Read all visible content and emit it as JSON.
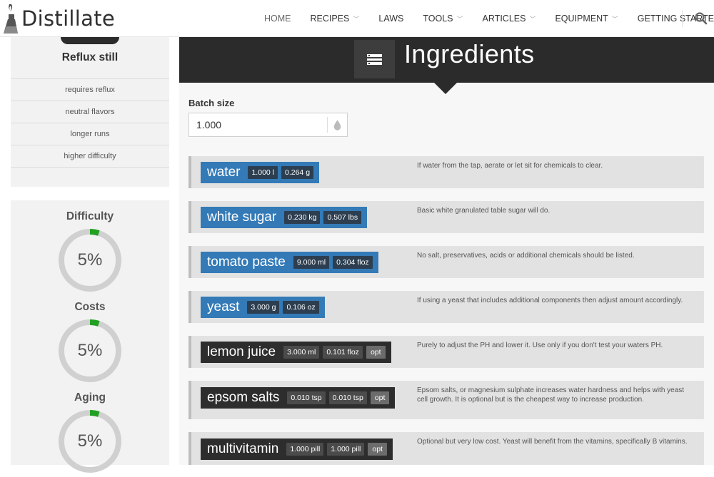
{
  "brand": {
    "name": "Distillate"
  },
  "nav": {
    "items": [
      {
        "label": "HOME",
        "dropdown": false,
        "active": true
      },
      {
        "label": "RECIPES",
        "dropdown": true
      },
      {
        "label": "LAWS",
        "dropdown": false
      },
      {
        "label": "TOOLS",
        "dropdown": true
      },
      {
        "label": "ARTICLES",
        "dropdown": true
      },
      {
        "label": "EQUIPMENT",
        "dropdown": true
      },
      {
        "label": "GETTING STARTED",
        "dropdown": true
      }
    ],
    "search_icon": "search-icon"
  },
  "still_card": {
    "title": "Reflux still",
    "traits": [
      "requires reflux",
      "neutral flavors",
      "longer runs",
      "higher difficulty"
    ]
  },
  "stats": [
    {
      "label": "Difficulty",
      "value": "5%",
      "percent": 5
    },
    {
      "label": "Costs",
      "value": "5%",
      "percent": 5
    },
    {
      "label": "Aging",
      "value": "5%",
      "percent": 5
    }
  ],
  "colors": {
    "gauge_track": "#d0d0d0",
    "gauge_fill": "#22a022",
    "pill_blue": "#337ab7",
    "pill_dark": "#2d2d2d",
    "header_dark": "#2b2b2b"
  },
  "section": {
    "title": "Ingredients",
    "icon": "list-icon"
  },
  "batch": {
    "label": "Batch size",
    "value": "1.000",
    "addon_icon": "drop-icon"
  },
  "ingredients": [
    {
      "name": "water",
      "style": "blue",
      "amounts": [
        "1.000 l",
        "0.264 g"
      ],
      "optional": false,
      "note": "If water from the tap, aerate or let sit for chemicals to clear."
    },
    {
      "name": "white sugar",
      "style": "blue",
      "amounts": [
        "0.230 kg",
        "0.507 lbs"
      ],
      "optional": false,
      "note": "Basic white granulated table sugar will do."
    },
    {
      "name": "tomato paste",
      "style": "blue",
      "amounts": [
        "9.000 ml",
        "0.304 floz"
      ],
      "optional": false,
      "note": "No salt, preservatives, acids or additional chemicals should be listed."
    },
    {
      "name": "yeast",
      "style": "blue",
      "amounts": [
        "3.000 g",
        "0.106 oz"
      ],
      "optional": false,
      "note": "If using a yeast that includes additional components then adjust amount accordingly."
    },
    {
      "name": "lemon juice",
      "style": "dark",
      "amounts": [
        "3.000 ml",
        "0.101 floz"
      ],
      "optional": true,
      "opt_label": "opt",
      "note": "Purely to adjust the PH and lower it. Use only if you don't test your waters PH."
    },
    {
      "name": "epsom salts",
      "style": "dark",
      "amounts": [
        "0.010 tsp",
        "0.010 tsp"
      ],
      "optional": true,
      "opt_label": "opt",
      "note": "Epsom salts, or magnesium sulphate increases water hardness and helps with yeast cell growth. It is optional but is the cheapest way to increase production."
    },
    {
      "name": "multivitamin",
      "style": "dark",
      "amounts": [
        "1.000 pill",
        "1.000 pill"
      ],
      "optional": true,
      "opt_label": "opt",
      "note": "Optional but very low cost. Yeast will benefit from the vitamins, specifically B vitamins."
    }
  ]
}
